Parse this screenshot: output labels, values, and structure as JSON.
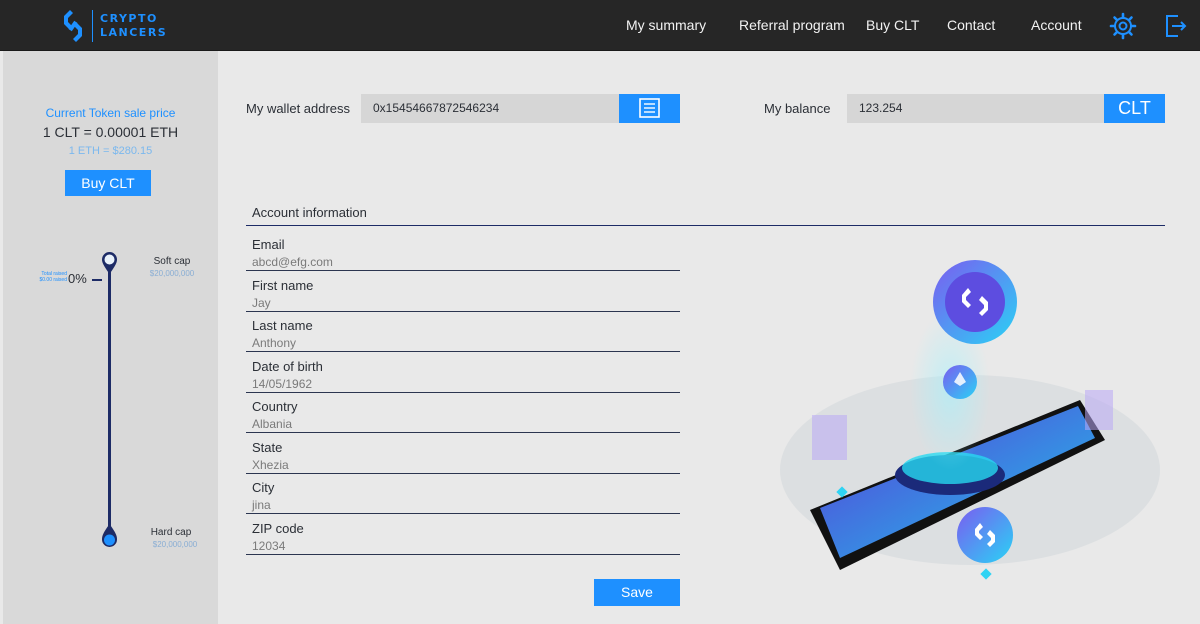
{
  "brand": {
    "line1": "CRYPTO",
    "line2": "LANCERS"
  },
  "nav": {
    "items": [
      "My summary",
      "Referral program",
      "Buy CLT",
      "Contact",
      "Account"
    ],
    "settings_icon": "gear-icon",
    "logout_icon": "logout-icon"
  },
  "sidebar": {
    "price_title": "Current Token sale price",
    "price_value": "1 CLT = 0.00001 ETH",
    "eth_rate": "1 ETH = $280.15",
    "buy_label": "Buy CLT",
    "progress": {
      "total_raised_label": "Total raised",
      "total_raised_value": "$0.00 raised",
      "percent": "0%",
      "soft_cap_label": "Soft cap",
      "soft_cap_value": "$20,000,000",
      "hard_cap_label": "Hard cap",
      "hard_cap_value": "$20,000,000"
    }
  },
  "wallet": {
    "label": "My wallet address",
    "value": "0x15454667872546234",
    "copy_icon": "document-icon"
  },
  "balance": {
    "label": "My balance",
    "value": "123.254",
    "unit": "CLT"
  },
  "account": {
    "title": "Account information",
    "fields": [
      {
        "label": "Email",
        "value": "abcd@efg.com"
      },
      {
        "label": "First name",
        "value": "Jay"
      },
      {
        "label": "Last name",
        "value": "Anthony"
      },
      {
        "label": "Date of birth",
        "value": "14/05/1962"
      },
      {
        "label": "Country",
        "value": "Albania"
      },
      {
        "label": "State",
        "value": "Xhezia"
      },
      {
        "label": "City",
        "value": "jina"
      },
      {
        "label": "ZIP code",
        "value": "12034"
      }
    ],
    "save_label": "Save"
  },
  "colors": {
    "accent": "#1e90ff",
    "navy": "#1d2b66",
    "topbar": "#262626"
  }
}
